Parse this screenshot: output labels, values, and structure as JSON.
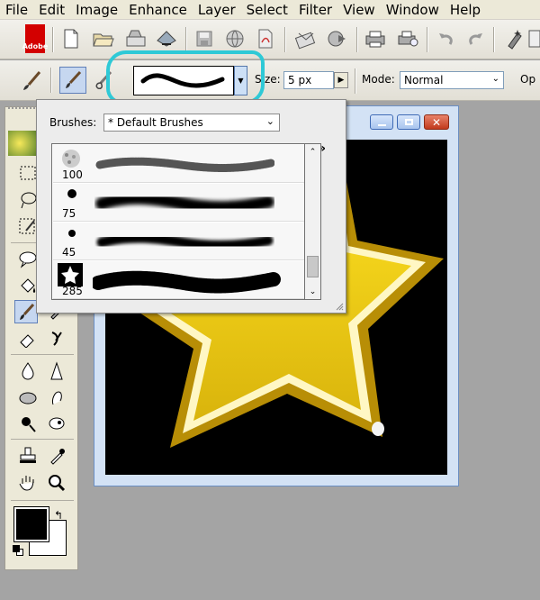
{
  "menu": {
    "items": [
      "File",
      "Edit",
      "Image",
      "Enhance",
      "Layer",
      "Select",
      "Filter",
      "View",
      "Window",
      "Help"
    ]
  },
  "toolbar": {
    "logo_text": "Adobe"
  },
  "options_bar": {
    "size_label": "Size:",
    "size_value": "5 px",
    "mode_label": "Mode:",
    "mode_value": "Normal",
    "opacity_label": "Op"
  },
  "brush_popup": {
    "brushes_label": "Brushes:",
    "brush_set": "* Default Brushes",
    "menu_glyph": "»",
    "brushes": [
      {
        "size": "100"
      },
      {
        "size": "75"
      },
      {
        "size": "45"
      },
      {
        "size": "285"
      }
    ]
  },
  "colors": {
    "foreground": "#000000",
    "background": "#ffffff",
    "highlight": "#2ec9d6",
    "star_fill": "#f2d21a",
    "star_rim": "#b88e06"
  }
}
